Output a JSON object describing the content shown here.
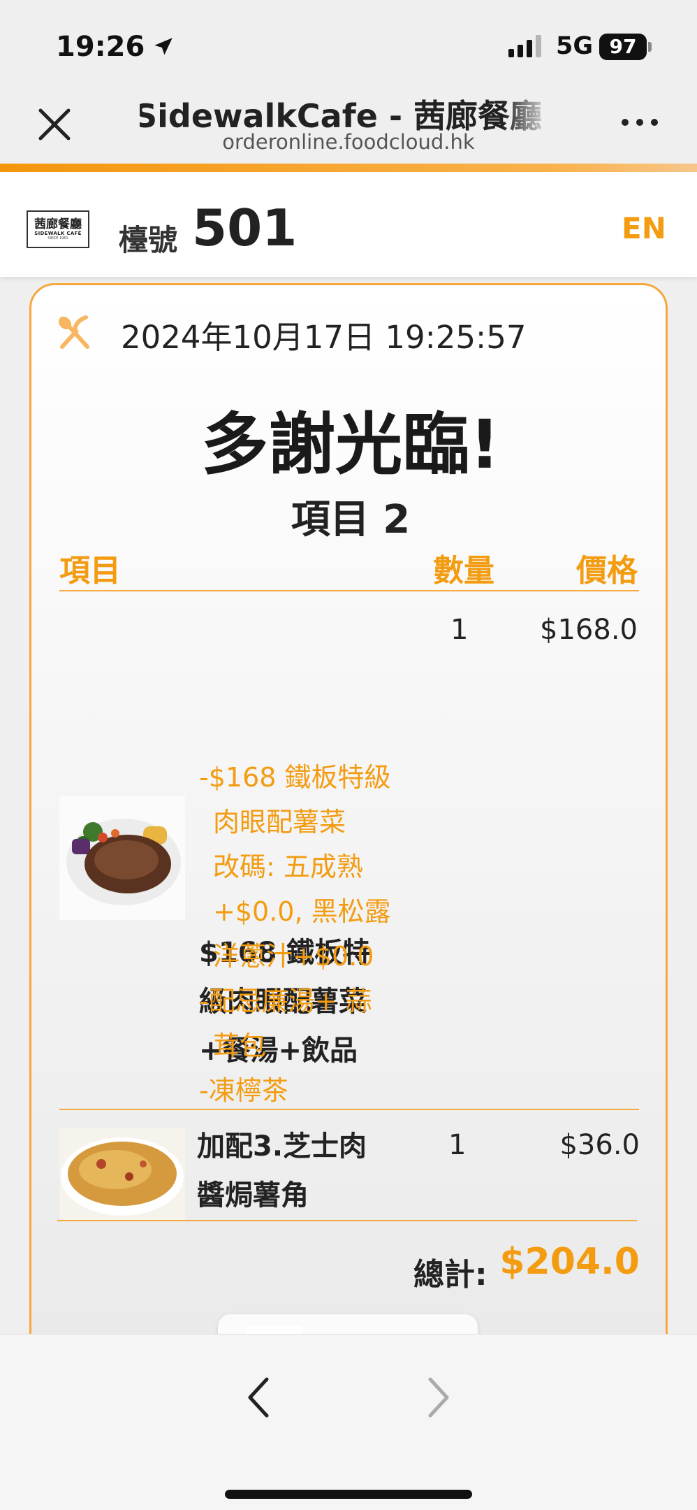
{
  "status_bar": {
    "time": "19:26",
    "network": "5G",
    "battery": "97"
  },
  "browser": {
    "title": "SidewalkCafe - 茜廊餐廳 (九龍",
    "url": "orderonline.foodcloud.hk"
  },
  "header": {
    "logo_text_cn": "茜廊餐廳",
    "logo_text_en": "SIDEWALK CAFÉ",
    "logo_since": "SINCE 1981",
    "table_label": "檯號",
    "table_number": "501",
    "language_button": "EN"
  },
  "receipt": {
    "datetime": "2024年10月17日 19:25:57",
    "thanks": "多謝光臨!",
    "item_count": "項目 2",
    "columns": {
      "item": "項目",
      "qty": "數量",
      "price": "價格"
    },
    "items": [
      {
        "name_lines": [
          "$168 鐵板特",
          "級肉眼配薯菜",
          "+餐湯+飲品"
        ],
        "qty": "1",
        "price": "$168.0",
        "options": [
          [
            "-$168 鐵板特級",
            "肉眼配薯菜",
            "改碼: 五成熟",
            "+$0.0, 黑松露",
            "洋蔥汁+$0.0"
          ],
          [
            "-配忌廉湯+ 蒜",
            "茸包"
          ],
          [
            "-凍檸茶"
          ]
        ]
      },
      {
        "name_lines": [
          "加配3.芝士肉",
          "醬焗薯角"
        ],
        "qty": "1",
        "price": "$36.0",
        "options": []
      }
    ],
    "total_label": "總計:",
    "total_value": "$204.0"
  },
  "colors": {
    "accent": "#f39c12",
    "card_border": "#f7a73e"
  }
}
